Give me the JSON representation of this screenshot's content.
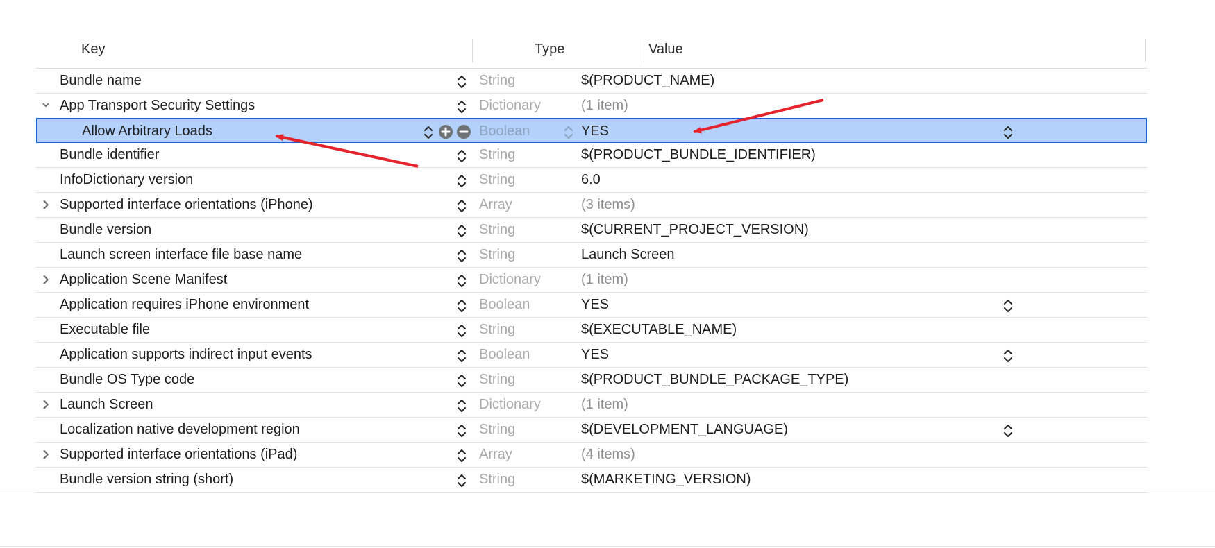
{
  "header": {
    "key_label": "Key",
    "type_label": "Type",
    "value_label": "Value"
  },
  "rows": [
    {
      "key": "Bundle name",
      "type": "String",
      "value": "$(PRODUCT_NAME)",
      "disclosure": "",
      "value_popup": false
    },
    {
      "key": "App Transport Security Settings",
      "type": "Dictionary",
      "value": "(1 item)",
      "disclosure": "expanded",
      "value_popup": false
    },
    {
      "key": "Allow Arbitrary Loads",
      "type": "Boolean",
      "value": "YES",
      "disclosure": "",
      "value_popup": true,
      "selected": true,
      "child": true
    },
    {
      "key": "Bundle identifier",
      "type": "String",
      "value": "$(PRODUCT_BUNDLE_IDENTIFIER)",
      "disclosure": "",
      "value_popup": false
    },
    {
      "key": "InfoDictionary version",
      "type": "String",
      "value": "6.0",
      "disclosure": "",
      "value_popup": false
    },
    {
      "key": "Supported interface orientations (iPhone)",
      "type": "Array",
      "value": "(3 items)",
      "disclosure": "collapsed",
      "value_popup": false
    },
    {
      "key": "Bundle version",
      "type": "String",
      "value": "$(CURRENT_PROJECT_VERSION)",
      "disclosure": "",
      "value_popup": false
    },
    {
      "key": "Launch screen interface file base name",
      "type": "String",
      "value": "Launch Screen",
      "disclosure": "",
      "value_popup": false
    },
    {
      "key": "Application Scene Manifest",
      "type": "Dictionary",
      "value": "(1 item)",
      "disclosure": "collapsed",
      "value_popup": false
    },
    {
      "key": "Application requires iPhone environment",
      "type": "Boolean",
      "value": "YES",
      "disclosure": "",
      "value_popup": true
    },
    {
      "key": "Executable file",
      "type": "String",
      "value": "$(EXECUTABLE_NAME)",
      "disclosure": "",
      "value_popup": false
    },
    {
      "key": "Application supports indirect input events",
      "type": "Boolean",
      "value": "YES",
      "disclosure": "",
      "value_popup": true
    },
    {
      "key": "Bundle OS Type code",
      "type": "String",
      "value": "$(PRODUCT_BUNDLE_PACKAGE_TYPE)",
      "disclosure": "",
      "value_popup": false
    },
    {
      "key": "Launch Screen",
      "type": "Dictionary",
      "value": "(1 item)",
      "disclosure": "collapsed",
      "value_popup": false
    },
    {
      "key": "Localization native development region",
      "type": "String",
      "value": "$(DEVELOPMENT_LANGUAGE)",
      "disclosure": "",
      "value_popup": true
    },
    {
      "key": "Supported interface orientations (iPad)",
      "type": "Array",
      "value": "(4 items)",
      "disclosure": "collapsed",
      "value_popup": false
    },
    {
      "key": "Bundle version string (short)",
      "type": "String",
      "value": "$(MARKETING_VERSION)",
      "disclosure": "",
      "value_popup": false
    }
  ],
  "icons": {
    "stepper": "up-down-chevron-icon",
    "add": "plus-circle-icon",
    "remove": "minus-circle-icon",
    "expanded": "chevron-down-icon",
    "collapsed": "chevron-right-icon"
  },
  "colors": {
    "selection_fill": "#b3d1fb",
    "selection_border": "#1f64d8",
    "annotation_arrow": "#e5232d"
  }
}
